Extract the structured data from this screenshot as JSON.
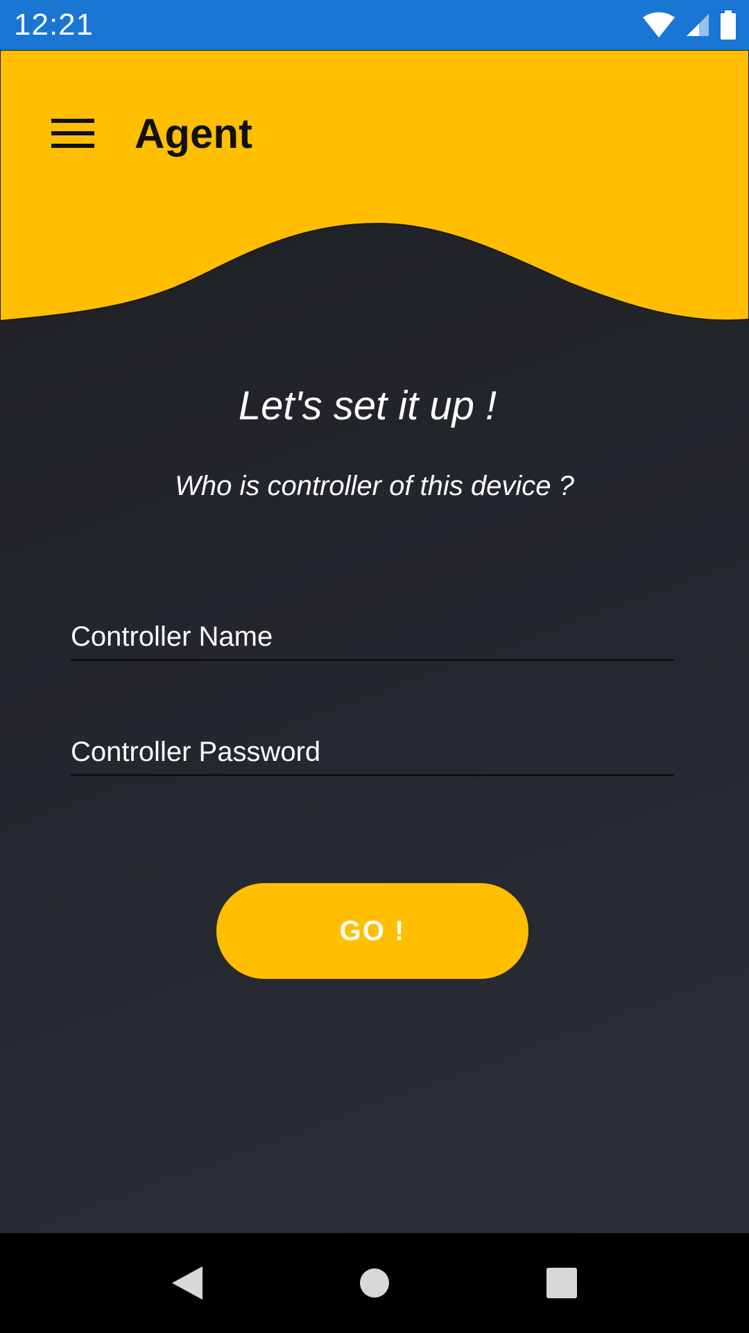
{
  "status_bar": {
    "time": "12:21",
    "icons": [
      "wifi-icon",
      "signal-icon",
      "battery-icon"
    ],
    "background": "#1976d2"
  },
  "header": {
    "menu_icon": "hamburger-menu-icon",
    "title": "Agent",
    "background": "#ffbf00"
  },
  "main": {
    "title": "Let's set it up !",
    "subtitle": "Who is controller of this device ?",
    "fields": {
      "controller_name": {
        "placeholder": "Controller Name",
        "value": ""
      },
      "controller_password": {
        "placeholder": "Controller Password",
        "value": ""
      }
    },
    "go_button": {
      "label": "GO !",
      "color": "#ffbf00"
    }
  },
  "nav_bar": {
    "buttons": [
      "back-icon",
      "home-icon",
      "recents-icon"
    ]
  }
}
